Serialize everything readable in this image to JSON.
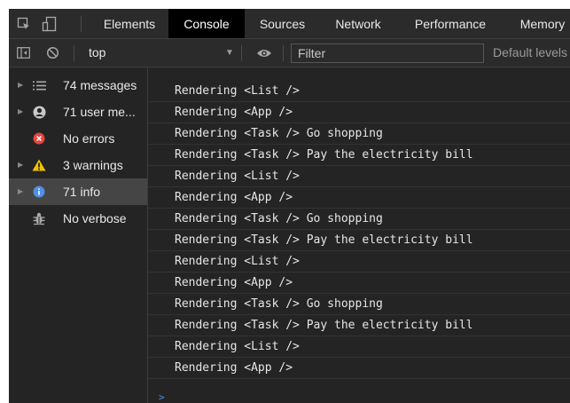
{
  "tabs": [
    {
      "label": "Elements"
    },
    {
      "label": "Console"
    },
    {
      "label": "Sources"
    },
    {
      "label": "Network"
    },
    {
      "label": "Performance"
    },
    {
      "label": "Memory"
    }
  ],
  "active_tab": "Console",
  "toolbar": {
    "context": "top",
    "filter_placeholder": "Filter",
    "levels_label": "Default levels"
  },
  "sidebar": {
    "items": [
      {
        "label": "74 messages",
        "icon": "list-icon",
        "expandable": true
      },
      {
        "label": "71 user me...",
        "icon": "user-icon",
        "expandable": true
      },
      {
        "label": "No errors",
        "icon": "error-icon",
        "expandable": false
      },
      {
        "label": "3 warnings",
        "icon": "warning-icon",
        "expandable": true
      },
      {
        "label": "71 info",
        "icon": "info-icon",
        "expandable": true,
        "selected": true
      },
      {
        "label": "No verbose",
        "icon": "bug-icon",
        "expandable": false
      }
    ]
  },
  "console": {
    "lines": [
      "Rendering <List />",
      "Rendering <App />",
      "Rendering <Task /> Go shopping",
      "Rendering <Task /> Pay the electricity bill",
      "Rendering <List />",
      "Rendering <App />",
      "Rendering <Task /> Go shopping",
      "Rendering <Task /> Pay the electricity bill",
      "Rendering <List />",
      "Rendering <App />",
      "Rendering <Task /> Go shopping",
      "Rendering <Task /> Pay the electricity bill",
      "Rendering <List />",
      "Rendering <App />"
    ],
    "prompt": ">"
  },
  "colors": {
    "background": "#242424",
    "toolbar": "#2b2b2b",
    "error": "#e8453c",
    "warning": "#f2c200",
    "info": "#4f8fe8",
    "selected": "#454545"
  }
}
